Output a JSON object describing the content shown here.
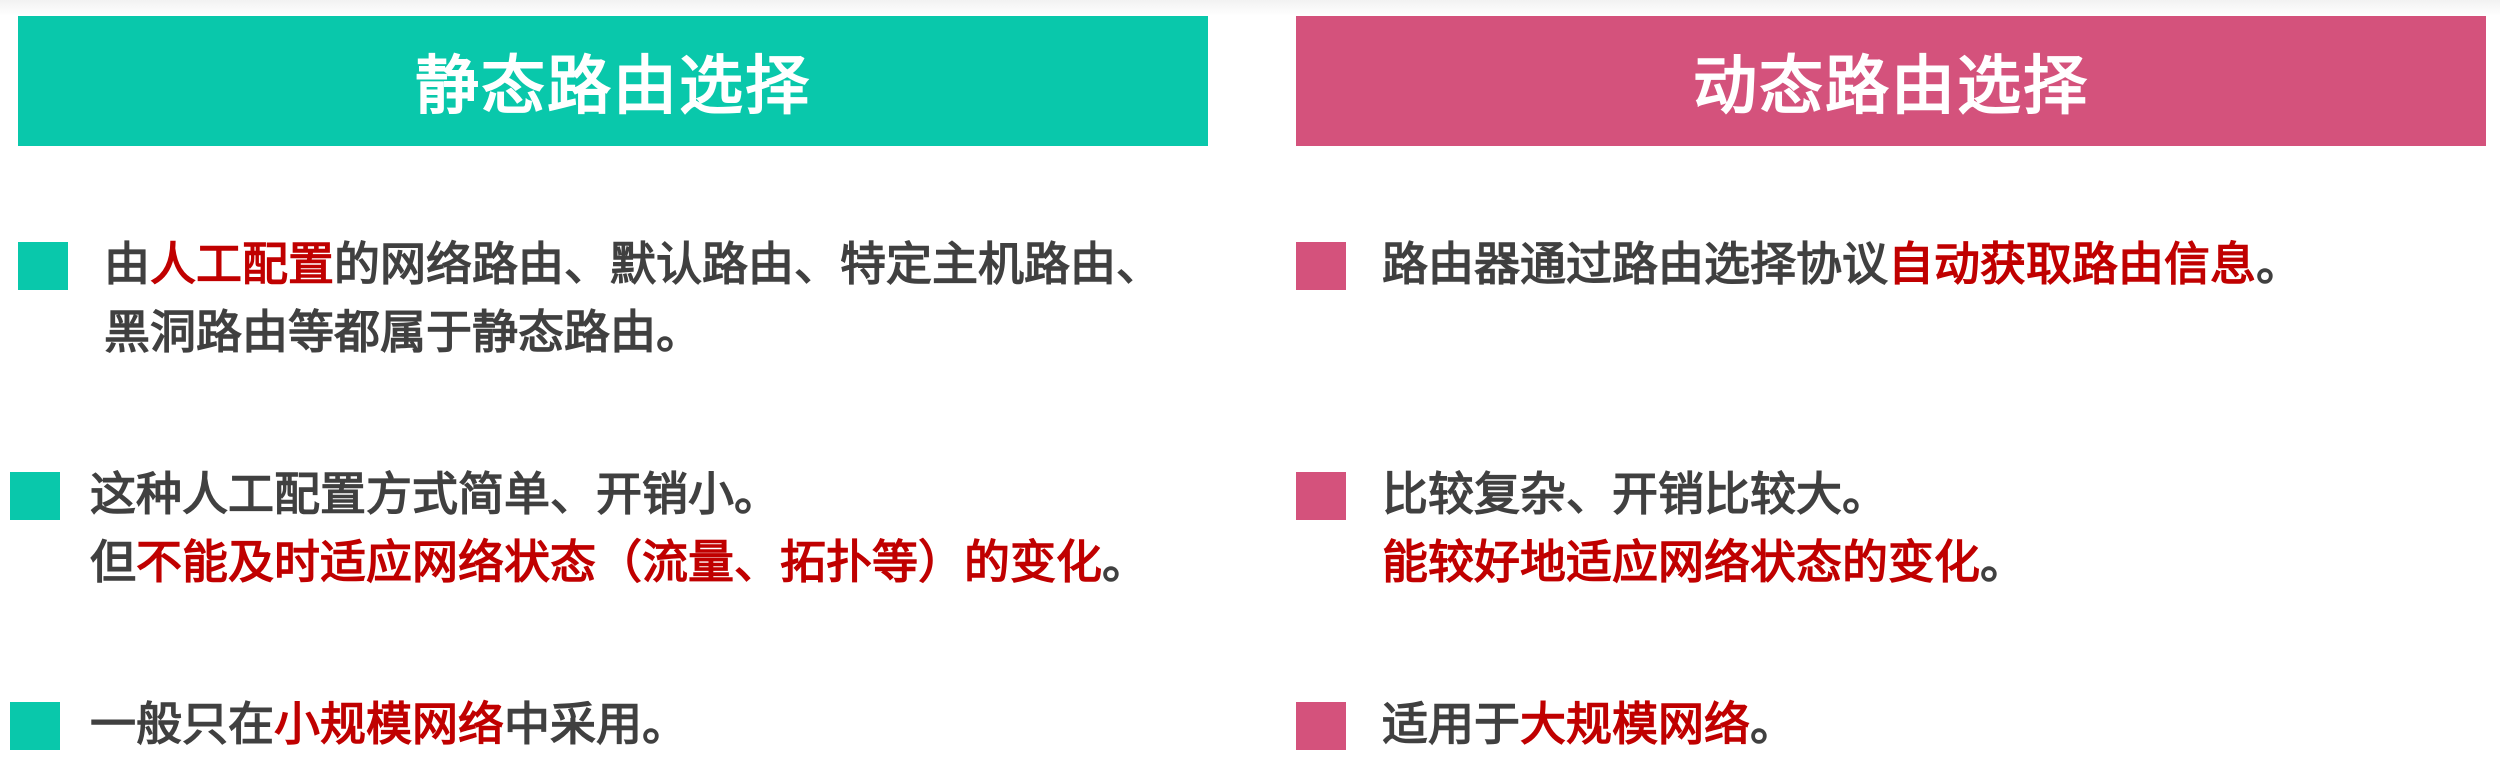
{
  "left": {
    "title": "静态路由选择",
    "items": [
      {
        "line1": {
          "a": "由",
          "b": "人工配置",
          "c": "的网络路由、默认路由、特定主机路由、"
        },
        "line2": "黑洞路由等都属于静态路由。"
      },
      {
        "line1": "这种人工配置方式简单、开销小。",
        "line2": {
          "a": "但",
          "b": "不能及时适应网络状态（流量、拓扑等）的变化",
          "c": "。"
        }
      },
      {
        "line1": {
          "a": "一般只在",
          "b": "小规模网络",
          "c": "中采用。"
        }
      }
    ]
  },
  "right": {
    "title": "动态路由选择",
    "items": [
      {
        "line1": {
          "a": "路由器通过路由选择协议",
          "b": "自动获取路由信息",
          "c": "。"
        }
      },
      {
        "line1": "比较复杂、开销比较大。",
        "line2": {
          "b": "能较好地适应网络状态的变化",
          "c": "。"
        }
      },
      {
        "line1": {
          "a": "适用于",
          "b": "大规模网络",
          "c": "。"
        }
      }
    ]
  },
  "colors": {
    "teal": "#09c8ab",
    "pink": "#d4527c",
    "highlight": "#c00000",
    "text": "#404040"
  }
}
